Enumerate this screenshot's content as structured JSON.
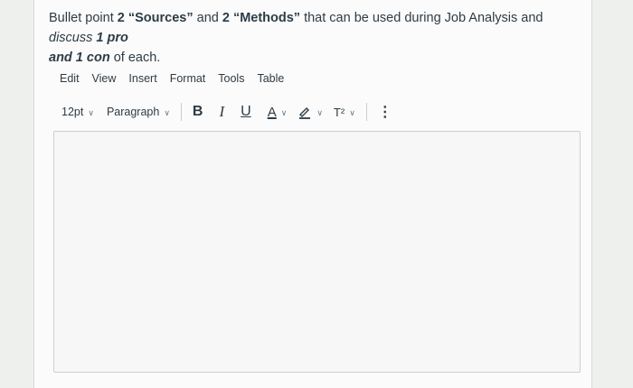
{
  "question": {
    "p1": "Bullet point ",
    "p2": "2 “Sources”",
    "p3": " and ",
    "p4": "2 “Methods”",
    "p5": " that can be used during Job Analysis and ",
    "p6": "discuss",
    "p7": " ",
    "p8": "1 pro",
    "p9": "and 1 con",
    "p10": " of each."
  },
  "menu": {
    "items": [
      "Edit",
      "View",
      "Insert",
      "Format",
      "Tools",
      "Table"
    ]
  },
  "toolbar": {
    "font_size": "12pt",
    "block_format": "Paragraph",
    "bold": "B",
    "italic": "I",
    "underline": "U",
    "text_color": "A",
    "superscript": "T²",
    "more": "⋮"
  },
  "editor": {
    "content": ""
  }
}
